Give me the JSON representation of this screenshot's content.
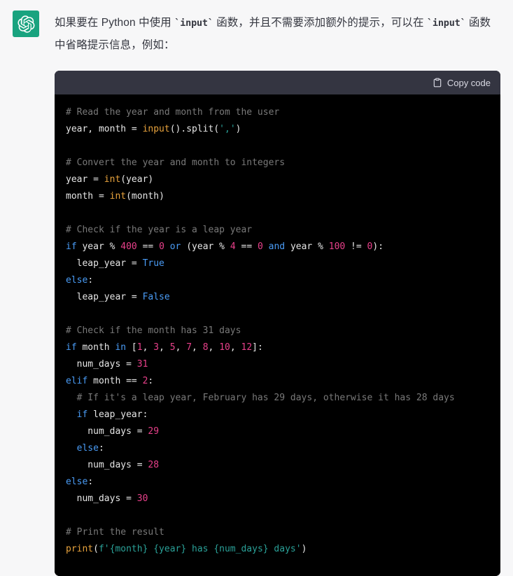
{
  "avatar": {
    "icon": "chatgpt-logo-icon",
    "bg_color": "#19a37f"
  },
  "message": {
    "paragraph_part1": "如果要在 Python 中使用 ",
    "inline_code_1": "`input`",
    "paragraph_part2": " 函数，并且不需要添加额外的提示，可以在 ",
    "inline_code_2": "`input`",
    "paragraph_part3": " 函数中省略提示信息，例如："
  },
  "code_block": {
    "copy_label": "Copy code",
    "copy_icon": "clipboard-icon",
    "language": "python",
    "header_bg": "#343541",
    "body_bg": "#000000",
    "colors": {
      "comment": "#797979",
      "keyword": "#4a9cf6",
      "number": "#e8408a",
      "function": "#e8a33d",
      "string": "#2aa198",
      "plain": "#e6e6e6"
    },
    "lines": [
      [
        {
          "t": "# Read the year and month from the user",
          "c": "t-com"
        }
      ],
      [
        {
          "t": "year, month = ",
          "c": "t-plain"
        },
        {
          "t": "input",
          "c": "t-fn"
        },
        {
          "t": "().split(",
          "c": "t-plain"
        },
        {
          "t": "','",
          "c": "t-str"
        },
        {
          "t": ")",
          "c": "t-plain"
        }
      ],
      [],
      [
        {
          "t": "# Convert the year and month to integers",
          "c": "t-com"
        }
      ],
      [
        {
          "t": "year = ",
          "c": "t-plain"
        },
        {
          "t": "int",
          "c": "t-fn"
        },
        {
          "t": "(year)",
          "c": "t-plain"
        }
      ],
      [
        {
          "t": "month = ",
          "c": "t-plain"
        },
        {
          "t": "int",
          "c": "t-fn"
        },
        {
          "t": "(month)",
          "c": "t-plain"
        }
      ],
      [],
      [
        {
          "t": "# Check if the year is a leap year",
          "c": "t-com"
        }
      ],
      [
        {
          "t": "if",
          "c": "t-kw"
        },
        {
          "t": " year % ",
          "c": "t-plain"
        },
        {
          "t": "400",
          "c": "t-num"
        },
        {
          "t": " == ",
          "c": "t-plain"
        },
        {
          "t": "0",
          "c": "t-num"
        },
        {
          "t": " ",
          "c": "t-plain"
        },
        {
          "t": "or",
          "c": "t-kw"
        },
        {
          "t": " (year % ",
          "c": "t-plain"
        },
        {
          "t": "4",
          "c": "t-num"
        },
        {
          "t": " == ",
          "c": "t-plain"
        },
        {
          "t": "0",
          "c": "t-num"
        },
        {
          "t": " ",
          "c": "t-plain"
        },
        {
          "t": "and",
          "c": "t-kw"
        },
        {
          "t": " year % ",
          "c": "t-plain"
        },
        {
          "t": "100",
          "c": "t-num"
        },
        {
          "t": " != ",
          "c": "t-plain"
        },
        {
          "t": "0",
          "c": "t-num"
        },
        {
          "t": "):",
          "c": "t-plain"
        }
      ],
      [
        {
          "t": "  leap_year = ",
          "c": "t-plain"
        },
        {
          "t": "True",
          "c": "t-kw"
        }
      ],
      [
        {
          "t": "else",
          "c": "t-kw"
        },
        {
          "t": ":",
          "c": "t-plain"
        }
      ],
      [
        {
          "t": "  leap_year = ",
          "c": "t-plain"
        },
        {
          "t": "False",
          "c": "t-kw"
        }
      ],
      [],
      [
        {
          "t": "# Check if the month has 31 days",
          "c": "t-com"
        }
      ],
      [
        {
          "t": "if",
          "c": "t-kw"
        },
        {
          "t": " month ",
          "c": "t-plain"
        },
        {
          "t": "in",
          "c": "t-kw"
        },
        {
          "t": " [",
          "c": "t-plain"
        },
        {
          "t": "1",
          "c": "t-num"
        },
        {
          "t": ", ",
          "c": "t-plain"
        },
        {
          "t": "3",
          "c": "t-num"
        },
        {
          "t": ", ",
          "c": "t-plain"
        },
        {
          "t": "5",
          "c": "t-num"
        },
        {
          "t": ", ",
          "c": "t-plain"
        },
        {
          "t": "7",
          "c": "t-num"
        },
        {
          "t": ", ",
          "c": "t-plain"
        },
        {
          "t": "8",
          "c": "t-num"
        },
        {
          "t": ", ",
          "c": "t-plain"
        },
        {
          "t": "10",
          "c": "t-num"
        },
        {
          "t": ", ",
          "c": "t-plain"
        },
        {
          "t": "12",
          "c": "t-num"
        },
        {
          "t": "]:",
          "c": "t-plain"
        }
      ],
      [
        {
          "t": "  num_days = ",
          "c": "t-plain"
        },
        {
          "t": "31",
          "c": "t-num"
        }
      ],
      [
        {
          "t": "elif",
          "c": "t-kw"
        },
        {
          "t": " month == ",
          "c": "t-plain"
        },
        {
          "t": "2",
          "c": "t-num"
        },
        {
          "t": ":",
          "c": "t-plain"
        }
      ],
      [
        {
          "t": "  # If it's a leap year, February has 29 days, otherwise it has 28 days",
          "c": "t-com"
        }
      ],
      [
        {
          "t": "  ",
          "c": "t-plain"
        },
        {
          "t": "if",
          "c": "t-kw"
        },
        {
          "t": " leap_year:",
          "c": "t-plain"
        }
      ],
      [
        {
          "t": "    num_days = ",
          "c": "t-plain"
        },
        {
          "t": "29",
          "c": "t-num"
        }
      ],
      [
        {
          "t": "  ",
          "c": "t-plain"
        },
        {
          "t": "else",
          "c": "t-kw"
        },
        {
          "t": ":",
          "c": "t-plain"
        }
      ],
      [
        {
          "t": "    num_days = ",
          "c": "t-plain"
        },
        {
          "t": "28",
          "c": "t-num"
        }
      ],
      [
        {
          "t": "else",
          "c": "t-kw"
        },
        {
          "t": ":",
          "c": "t-plain"
        }
      ],
      [
        {
          "t": "  num_days = ",
          "c": "t-plain"
        },
        {
          "t": "30",
          "c": "t-num"
        }
      ],
      [],
      [
        {
          "t": "# Print the result",
          "c": "t-com"
        }
      ],
      [
        {
          "t": "print",
          "c": "t-fn"
        },
        {
          "t": "(",
          "c": "t-plain"
        },
        {
          "t": "f'{month} {year} has {num_days} days'",
          "c": "t-str"
        },
        {
          "t": ")",
          "c": "t-plain"
        }
      ]
    ]
  }
}
